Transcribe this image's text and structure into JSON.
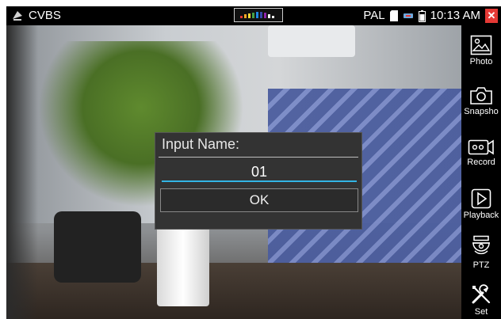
{
  "status_bar": {
    "source": "CVBS",
    "signal_standard": "PAL",
    "time": "10:13 AM"
  },
  "dialog": {
    "title": "Input Name:",
    "input_value": "01",
    "ok_label": "OK"
  },
  "toolbar": [
    {
      "label": "Photo",
      "icon": "photo-icon"
    },
    {
      "label": "Snapsho",
      "icon": "camera-icon"
    },
    {
      "label": "Record",
      "icon": "record-icon"
    },
    {
      "label": "Playback",
      "icon": "play-icon"
    },
    {
      "label": "PTZ",
      "icon": "ptz-camera-icon"
    },
    {
      "label": "Set",
      "icon": "tools-icon"
    }
  ],
  "colors": {
    "accent": "#33b5e5",
    "close": "#e53935",
    "dialog_bg": "#333333"
  }
}
